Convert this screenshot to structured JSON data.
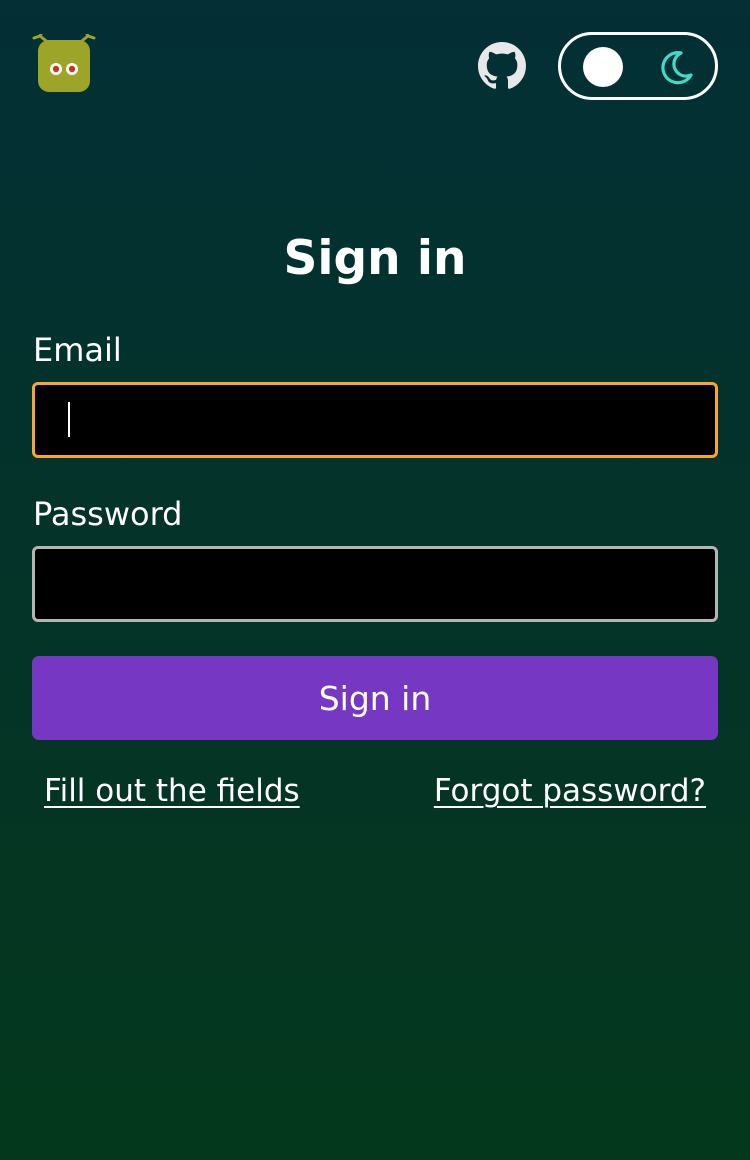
{
  "header": {
    "logo_icon": "alien-logo-icon",
    "github_icon": "github-icon",
    "theme_toggle": {
      "knob_icon": "circle-knob",
      "mode_icon": "moon-icon",
      "moon_color": "#3ddbc8"
    }
  },
  "form": {
    "title": "Sign in",
    "email_label": "Email",
    "email_value": "",
    "password_label": "Password",
    "password_value": "",
    "submit_label": "Sign in",
    "fill_fields_link": "Fill out the fields",
    "forgot_password_link": "Forgot password?"
  },
  "colors": {
    "background_top": "#032f35",
    "background_bottom": "#04381c",
    "button": "#7638c2",
    "focus_border": "#f9a72b",
    "input_border": "#b5b5b5",
    "logo": "#9ca528"
  }
}
